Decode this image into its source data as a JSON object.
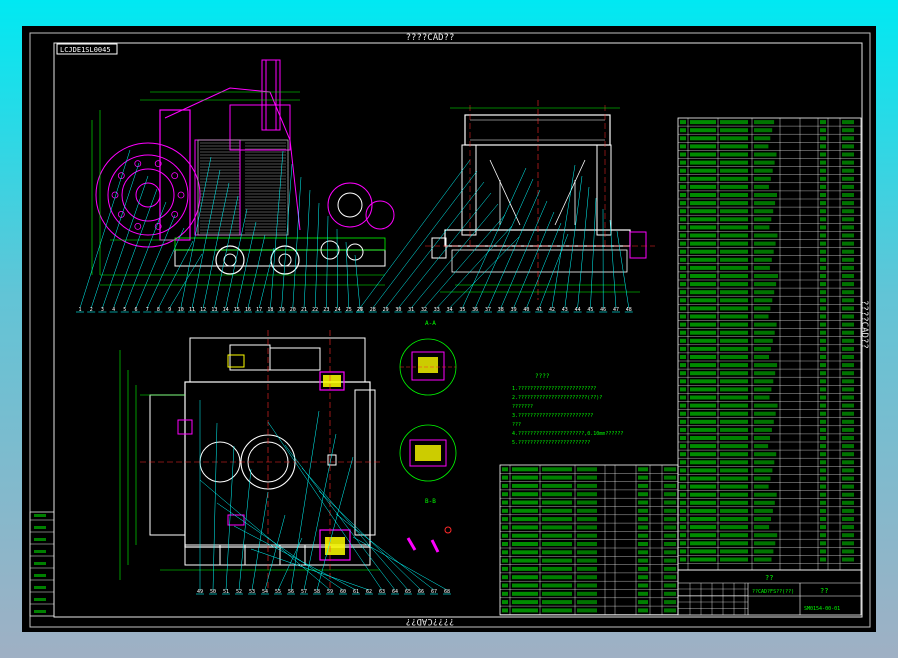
{
  "drawing": {
    "top_title": "????CAD??",
    "bottom_title": "????CAD??",
    "side_title": "????CAD??",
    "drawing_number": "LCJDE1SL0045",
    "section_label": "????",
    "detail_label_1": "A-A",
    "detail_label_2": "B-B",
    "title_block_main": "??",
    "title_block_sub": "??CAD?FS??(??)",
    "title_block_right": "??",
    "title_block_code": "SM0154-00-01",
    "notes_title": "????",
    "notes": [
      "1.??????????????????????????",
      "2.???????????????????????(??)?",
      "  ???????",
      "3.?????????????????????????",
      "  ???",
      "4.??????????????????????,0.10mm??????",
      "5.????????????????????????"
    ],
    "balloons_row1": [
      "1",
      "2",
      "3",
      "4",
      "5",
      "6",
      "7",
      "8",
      "9",
      "10",
      "11",
      "12",
      "13",
      "14",
      "15",
      "16",
      "17",
      "18",
      "19",
      "20",
      "21",
      "22",
      "23",
      "24",
      "25",
      "26",
      "27",
      "28",
      "29",
      "30",
      "31",
      "32",
      "33",
      "34",
      "35",
      "36",
      "37",
      "38",
      "39",
      "40",
      "41",
      "42",
      "43",
      "44",
      "45",
      "46",
      "47",
      "48"
    ],
    "balloons_row2": [
      "49",
      "50",
      "51",
      "52",
      "53",
      "54",
      "55",
      "56",
      "57",
      "58",
      "59",
      "60",
      "61",
      "62",
      "63",
      "64",
      "65",
      "66",
      "67",
      "68"
    ]
  },
  "colors": {
    "canvas": "#000000",
    "frame": "#d9d9d9",
    "green": "#00ff00",
    "magenta": "#ff00ff",
    "cyan": "#00ffff",
    "yellow": "#ffff00",
    "red": "#ff2a2a",
    "white": "#ffffff"
  }
}
